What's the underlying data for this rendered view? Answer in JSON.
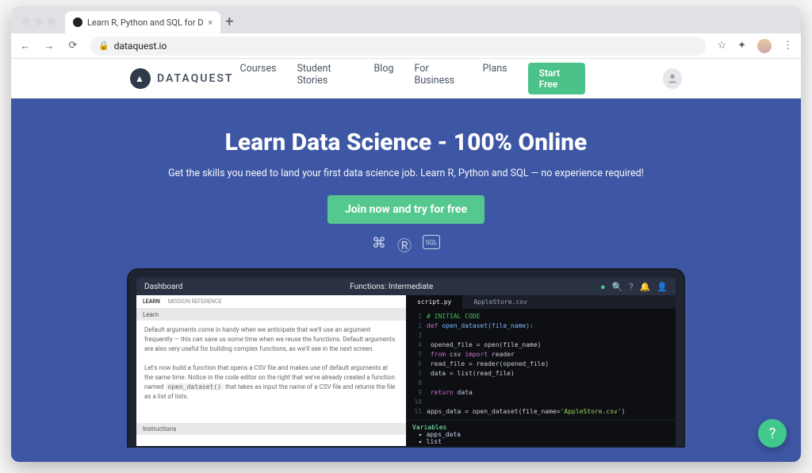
{
  "browser": {
    "tab_title": "Learn R, Python and SQL for D",
    "url": "dataquest.io"
  },
  "header": {
    "brand": "DATAQUEST",
    "nav": [
      "Courses",
      "Student Stories",
      "Blog",
      "For Business",
      "Plans"
    ],
    "start_label": "Start Free"
  },
  "hero": {
    "title": "Learn Data Science - 100% Online",
    "subtitle": "Get the skills you need to land your first data science job. Learn R, Python and SQL — no experience required!",
    "cta": "Join now and try for free"
  },
  "app": {
    "crumb": "Dashboard",
    "title": "Functions: Intermediate",
    "left_tabs": [
      "LEARN",
      "MISSION REFERENCE"
    ],
    "learn_header": "Learn",
    "para1": "Default arguments come in handy when we anticipate that we'll use an argument frequently — this can save us some time when we reuse the functions. Default arguments are also very useful for building complex functions, as we'll see in the next screen.",
    "para2a": "Let's now build a function that opens a CSV file and makes use of default arguments at the same time. Notice in the code editor on the right that we've already created a function named ",
    "para2code": "open_dataset()",
    "para2b": " that takes as input the name of a CSV file and returns the file as a list of lists.",
    "instructions_header": "Instructions",
    "script_tab": "script.py",
    "data_tab": "AppleStore.csv",
    "code": {
      "c1": "# INITIAL CODE",
      "c2a": "def",
      "c2b": " open_dataset(file_name):",
      "c4": "    opened_file = open(file_name)",
      "c5a": "    from",
      "c5b": " csv ",
      "c5c": "import",
      "c5d": " reader",
      "c6": "    read_file = reader(opened_file)",
      "c7": "    data = list(read_file)",
      "c9a": "    return",
      "c9b": " data",
      "c11a": "apps_data = open_dataset(file_name=",
      "c11b": "'AppleStore.csv'",
      "c11c": ")"
    },
    "vars_header": "Variables",
    "vars": [
      "apps_data",
      "list"
    ]
  }
}
